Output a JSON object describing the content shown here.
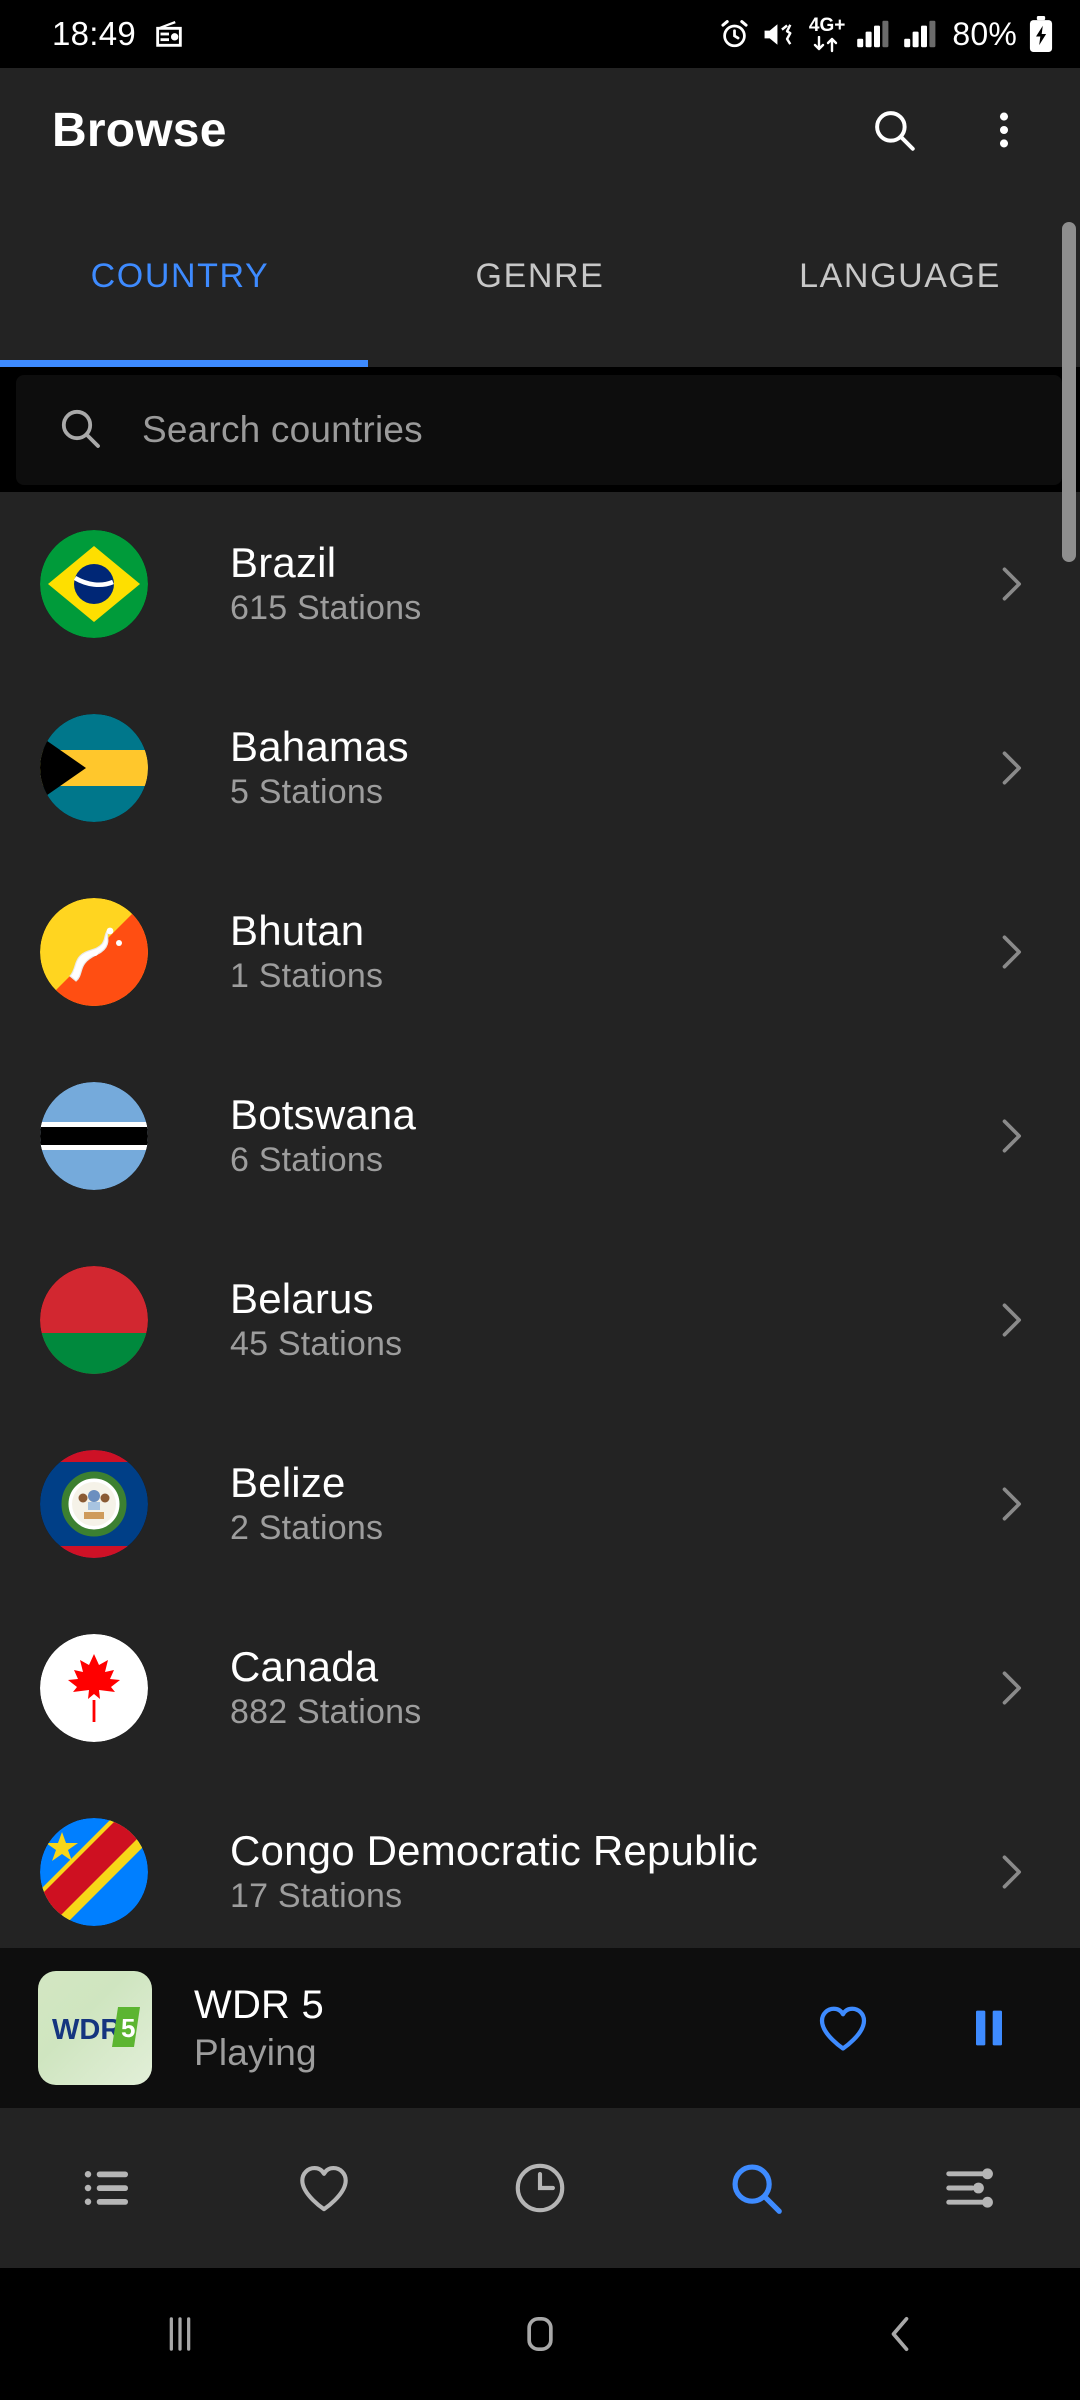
{
  "status_bar": {
    "clock": "18:49",
    "battery_percent": "80%",
    "network_type": "4G+",
    "icons": [
      "radio-icon",
      "alarm-icon",
      "vibrate-icon",
      "mobile-data-icon",
      "signal-sim1-icon",
      "signal-sim2-icon",
      "battery-charging-icon"
    ]
  },
  "app_bar": {
    "title": "Browse",
    "search_label": "Search",
    "overflow_label": "More options"
  },
  "tabs": [
    {
      "label": "COUNTRY",
      "active": true
    },
    {
      "label": "GENRE",
      "active": false
    },
    {
      "label": "LANGUAGE",
      "active": false
    }
  ],
  "search": {
    "placeholder": "Search countries",
    "value": ""
  },
  "countries": [
    {
      "name": "Brazil",
      "stations": "615 Stations",
      "flag": "br"
    },
    {
      "name": "Bahamas",
      "stations": "5 Stations",
      "flag": "bs"
    },
    {
      "name": "Bhutan",
      "stations": "1 Stations",
      "flag": "bt"
    },
    {
      "name": "Botswana",
      "stations": "6 Stations",
      "flag": "bw"
    },
    {
      "name": "Belarus",
      "stations": "45 Stations",
      "flag": "by"
    },
    {
      "name": "Belize",
      "stations": "2 Stations",
      "flag": "bz"
    },
    {
      "name": "Canada",
      "stations": "882 Stations",
      "flag": "ca"
    },
    {
      "name": "Congo Democratic Republic",
      "stations": "17 Stations",
      "flag": "cd"
    }
  ],
  "player": {
    "station_name": "WDR 5",
    "status": "Playing",
    "artwork_text_main": "WDR",
    "artwork_text_badge": "5",
    "favorite_label": "Favorite",
    "pause_label": "Pause"
  },
  "bottom_nav": [
    {
      "name": "list",
      "active": false
    },
    {
      "name": "favorites",
      "active": false
    },
    {
      "name": "history",
      "active": false
    },
    {
      "name": "search",
      "active": true
    },
    {
      "name": "settings",
      "active": false
    }
  ],
  "android_nav": [
    "recents",
    "home",
    "back"
  ],
  "colors": {
    "accent": "#3e8bff",
    "page_bg": "#232323",
    "field_bg": "#0d0d0d",
    "player_bg": "#0e0e0e",
    "primary_text": "#ffffff",
    "secondary_text": "#9d9d9d"
  }
}
